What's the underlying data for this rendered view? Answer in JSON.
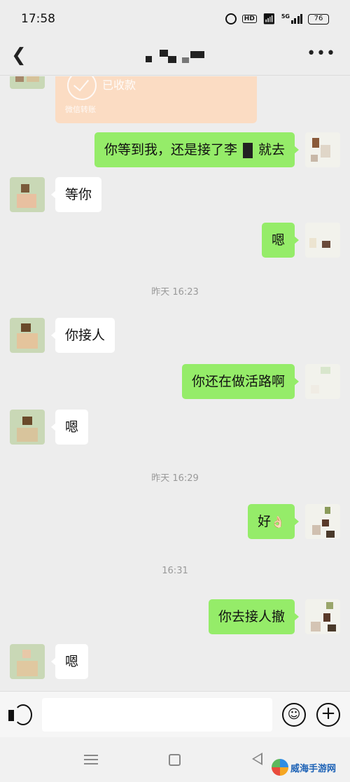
{
  "status_bar": {
    "time": "17:58",
    "hd_label": "HD",
    "network_label": "5G",
    "battery": "76"
  },
  "nav": {
    "back_icon": "chevron-left-icon",
    "contact_name": "",
    "more_icon": "more-icon"
  },
  "transfer": {
    "status": "已收款",
    "footer": "微信转账",
    "color": "#fbdcc3"
  },
  "messages": [
    {
      "side": "out",
      "text_a": "你等到我，还是接了李",
      "text_b": "就去"
    },
    {
      "side": "in",
      "text": "等你"
    },
    {
      "side": "out",
      "text": "嗯"
    },
    {
      "side": "in",
      "text": "你接人"
    },
    {
      "side": "out",
      "text": "你还在做活路啊"
    },
    {
      "side": "in",
      "text": "嗯"
    },
    {
      "side": "out",
      "text": "好",
      "emoji": "👌🏻"
    },
    {
      "side": "out",
      "text": "你去接人撤"
    },
    {
      "side": "in",
      "text": "嗯"
    }
  ],
  "timestamps": [
    "昨天 16:23",
    "昨天 16:29",
    "16:31"
  ],
  "input": {
    "value": "",
    "placeholder": "",
    "voice_icon": "voice-icon",
    "emoji_icon": "emoji-icon",
    "plus_icon": "plus-icon"
  },
  "colors": {
    "outgoing_bubble": "#95ec69",
    "incoming_bubble": "#ffffff",
    "background": "#ededed"
  },
  "watermark": {
    "text": "威海手游网"
  }
}
